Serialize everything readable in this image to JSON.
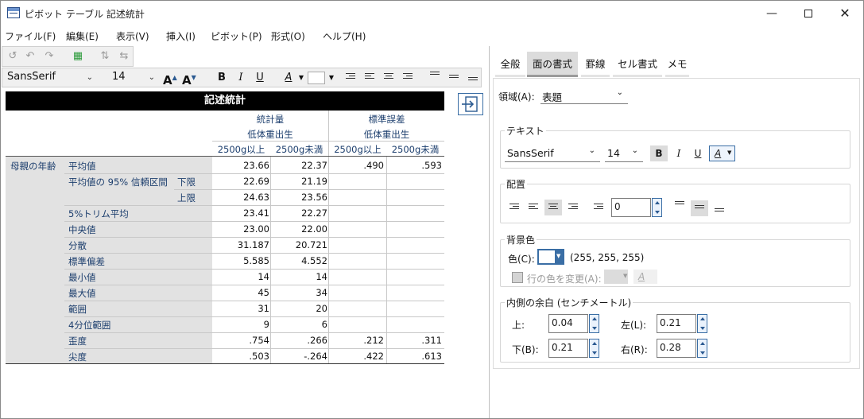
{
  "window": {
    "title": "ピボット テーブル 記述統計"
  },
  "menu": [
    "ファイル(F)",
    "編集(E)",
    "表示(V)",
    "挿入(I)",
    "ピボット(P)",
    "形式(O)",
    "ヘルプ(H)"
  ],
  "format_toolbar": {
    "font": "SansSerif",
    "size": "14",
    "bold": "B",
    "italic": "I",
    "underline": "U",
    "color_a": "A"
  },
  "table": {
    "title": "記述統計",
    "col_group_1": "統計量",
    "col_group_2": "標準誤差",
    "sub_group": "低体重出生",
    "col_a": "2500g以上",
    "col_b": "2500g未満",
    "row_group": "母親の年齢",
    "rows": [
      {
        "label": "平均値",
        "sub": "",
        "v1": "23.66",
        "v2": "22.37",
        "s1": ".490",
        "s2": ".593"
      },
      {
        "label": "平均値の 95% 信頼区間",
        "sub": "下限",
        "v1": "22.69",
        "v2": "21.19",
        "s1": "",
        "s2": ""
      },
      {
        "label": "",
        "sub": "上限",
        "v1": "24.63",
        "v2": "23.56",
        "s1": "",
        "s2": ""
      },
      {
        "label": "5%トリム平均",
        "sub": "",
        "v1": "23.41",
        "v2": "22.27",
        "s1": "",
        "s2": ""
      },
      {
        "label": "中央値",
        "sub": "",
        "v1": "23.00",
        "v2": "22.00",
        "s1": "",
        "s2": ""
      },
      {
        "label": "分散",
        "sub": "",
        "v1": "31.187",
        "v2": "20.721",
        "s1": "",
        "s2": ""
      },
      {
        "label": "標準偏差",
        "sub": "",
        "v1": "5.585",
        "v2": "4.552",
        "s1": "",
        "s2": ""
      },
      {
        "label": "最小値",
        "sub": "",
        "v1": "14",
        "v2": "14",
        "s1": "",
        "s2": ""
      },
      {
        "label": "最大値",
        "sub": "",
        "v1": "45",
        "v2": "34",
        "s1": "",
        "s2": ""
      },
      {
        "label": "範囲",
        "sub": "",
        "v1": "31",
        "v2": "20",
        "s1": "",
        "s2": ""
      },
      {
        "label": "4分位範囲",
        "sub": "",
        "v1": "9",
        "v2": "6",
        "s1": "",
        "s2": ""
      },
      {
        "label": "歪度",
        "sub": "",
        "v1": ".754",
        "v2": ".266",
        "s1": ".212",
        "s2": ".311"
      },
      {
        "label": "尖度",
        "sub": "",
        "v1": ".503",
        "v2": "-.264",
        "s1": ".422",
        "s2": ".613"
      }
    ]
  },
  "panel": {
    "tabs": [
      "全般",
      "面の書式",
      "罫線",
      "セル書式",
      "メモ"
    ],
    "active_tab": "面の書式",
    "area_label": "領域(A):",
    "area_value": "表題",
    "text_group": "テキスト",
    "text_font": "SansSerif",
    "text_size": "14",
    "bold": "B",
    "italic": "I",
    "underline": "U",
    "color_a": "A",
    "align_group": "配置",
    "indent_value": "0",
    "bg_group": "背景色",
    "color_label": "色(C):",
    "color_rgb": "(255, 255, 255)",
    "alt_row_label": "行の色を変更(A):",
    "margin_group": "内側の余白 (センチメートル)",
    "top_label": "上:",
    "top_value": "0.04",
    "left_label": "左(L):",
    "left_value": "0.21",
    "bottom_label": "下(B):",
    "bottom_value": "0.21",
    "right_label": "右(R):",
    "right_value": "0.28"
  },
  "colors": {
    "accent": "#3a6ea5",
    "title_bar": "#000000",
    "row_header_bg": "#e2e2e2"
  }
}
